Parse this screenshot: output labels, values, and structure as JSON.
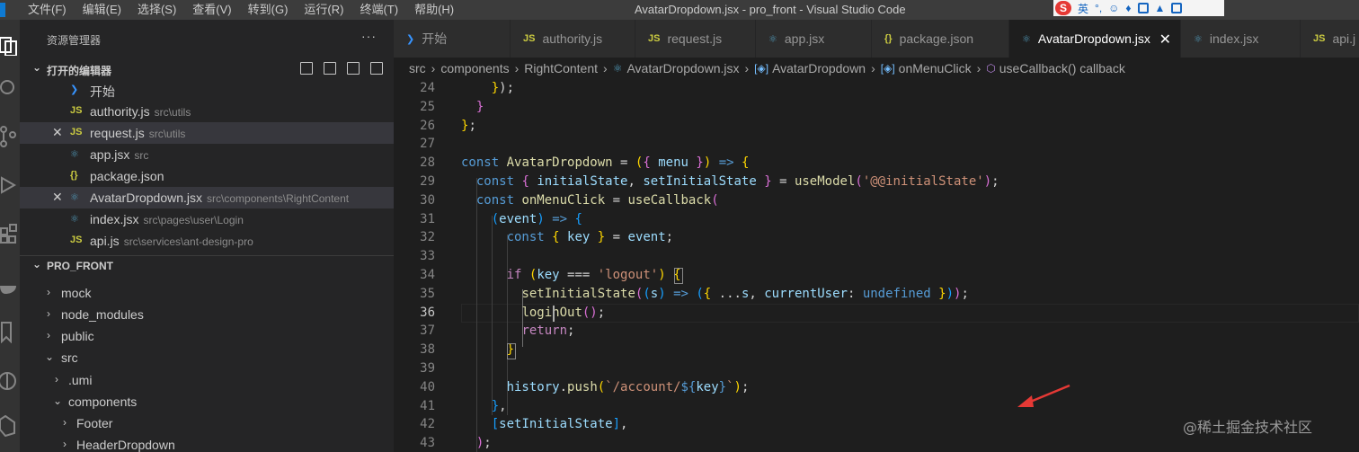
{
  "menu": [
    "文件(F)",
    "编辑(E)",
    "选择(S)",
    "查看(V)",
    "转到(G)",
    "运行(R)",
    "终端(T)",
    "帮助(H)"
  ],
  "window_title": "AvatarDropdown.jsx - pro_front - Visual Studio Code",
  "ime": {
    "lang": "英"
  },
  "sidebar": {
    "title": "资源管理器",
    "open_editors_label": "打开的编辑器",
    "open_editors": [
      {
        "name": "开始",
        "path": "",
        "icon": "vscode-icon"
      },
      {
        "name": "authority.js",
        "path": "src\\utils",
        "icon": "JS"
      },
      {
        "name": "request.js",
        "path": "src\\utils",
        "icon": "JS"
      },
      {
        "name": "app.jsx",
        "path": "src",
        "icon": "react-icon"
      },
      {
        "name": "package.json",
        "path": "",
        "icon": "{}"
      },
      {
        "name": "AvatarDropdown.jsx",
        "path": "src\\components\\RightContent",
        "icon": "react-icon"
      },
      {
        "name": "index.jsx",
        "path": "src\\pages\\user\\Login",
        "icon": "react-icon"
      },
      {
        "name": "api.js",
        "path": "src\\services\\ant-design-pro",
        "icon": "JS"
      }
    ],
    "project_label": "PRO_FRONT",
    "tree": [
      "mock",
      "node_modules",
      "public",
      "src",
      ".umi",
      "components",
      "Footer",
      "HeaderDropdown"
    ]
  },
  "tabs": [
    {
      "label": "开始",
      "icon": "vscode-icon"
    },
    {
      "label": "authority.js",
      "icon": "JS"
    },
    {
      "label": "request.js",
      "icon": "JS"
    },
    {
      "label": "app.jsx",
      "icon": "react-icon"
    },
    {
      "label": "package.json",
      "icon": "{}"
    },
    {
      "label": "AvatarDropdown.jsx",
      "icon": "react-icon",
      "active": true
    },
    {
      "label": "index.jsx",
      "icon": "react-icon"
    },
    {
      "label": "api.j",
      "icon": "JS"
    }
  ],
  "breadcrumb": [
    "src",
    "components",
    "RightContent",
    "AvatarDropdown.jsx",
    "AvatarDropdown",
    "onMenuClick",
    "useCallback() callback"
  ],
  "line_numbers": [
    "24",
    "25",
    "26",
    "27",
    "28",
    "29",
    "30",
    "31",
    "32",
    "33",
    "34",
    "35",
    "36",
    "37",
    "38",
    "39",
    "40",
    "41",
    "42",
    "43"
  ],
  "watermark": "@稀土掘金技术社区",
  "colors": {
    "accent": "#007acc",
    "arrow": "#e53935"
  }
}
